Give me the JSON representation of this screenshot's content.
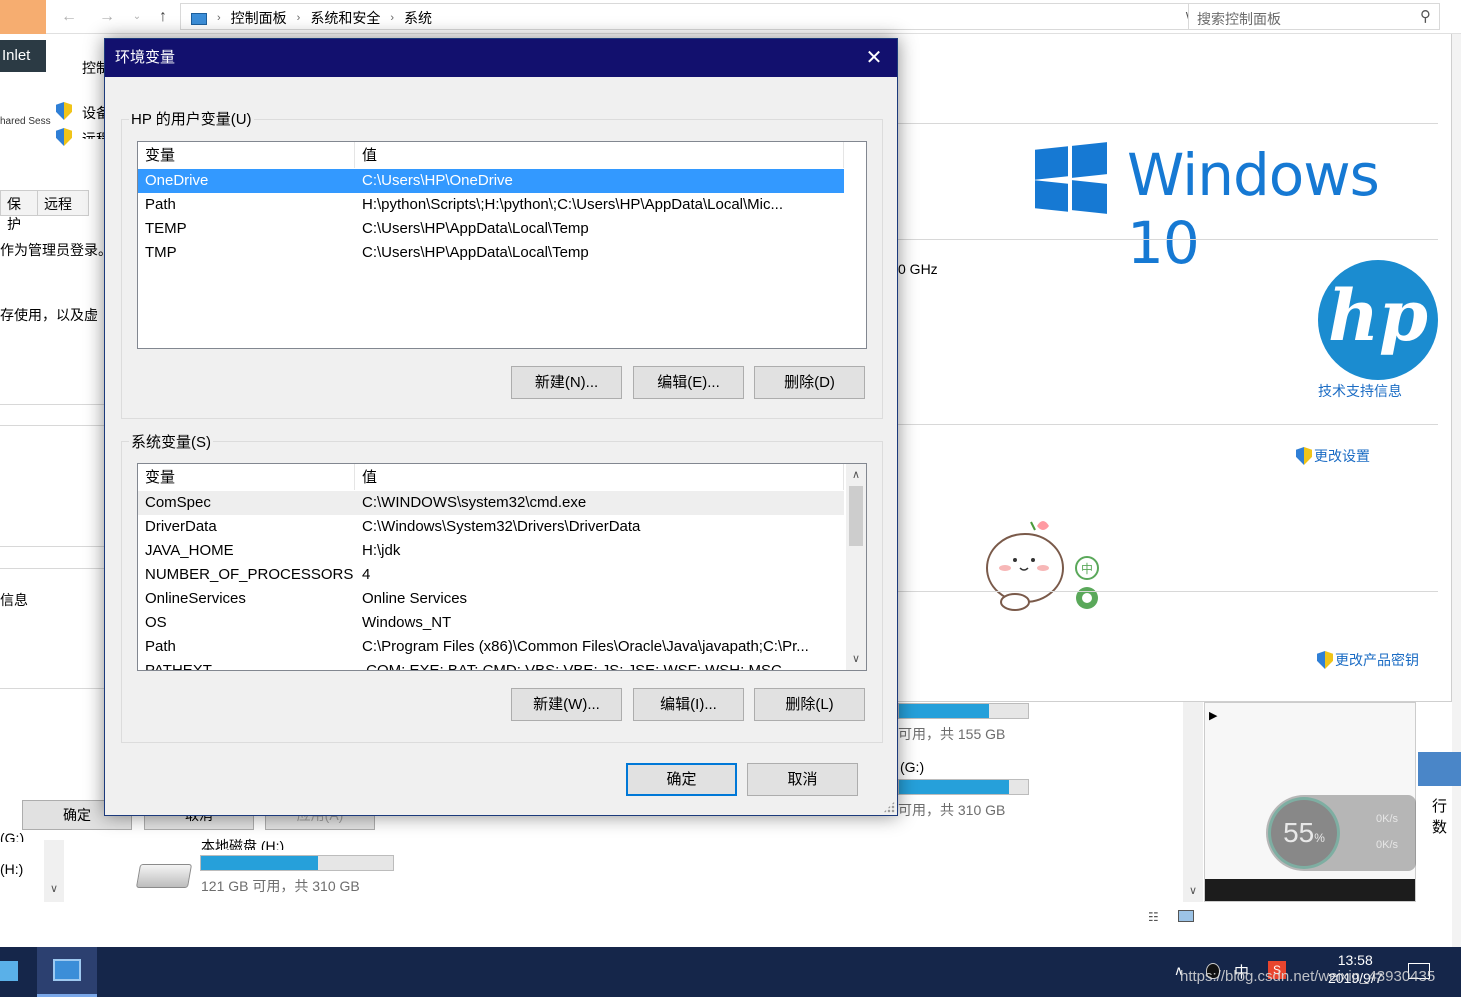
{
  "explorer": {
    "breadcrumbs": [
      "控制面板",
      "系统和安全",
      "系统"
    ],
    "search_placeholder": "搜索控制面板",
    "help_label": "?"
  },
  "system_page": {
    "windows_brand": "Windows 10",
    "cpu_freq_fragment": "0 GHz",
    "hp_logo_text": "hp",
    "tech_support_link": "技术支持信息",
    "change_settings_link": "更改设置",
    "change_product_key_link": "更改产品密钥"
  },
  "left_fragments": {
    "inlet": "Inlet",
    "shared_sess": "hared Sess",
    "left_link_1": "控制",
    "left_link_2": "设备",
    "left_link_3": "远程",
    "tab_protect": "保护",
    "tab_remote": "远程",
    "admin_text": "作为管理员登录。",
    "memory_text": "存使用，以及虚",
    "info_text": "信息",
    "drive_g_prefix": "(G:)",
    "drive_h_prefix": "(H:)"
  },
  "system_properties_buttons": {
    "ok": "确定",
    "cancel": "取消",
    "apply": "应用(A)"
  },
  "drives": [
    {
      "name": "",
      "free_text": "可用，共 155 GB",
      "fill": 0.7
    },
    {
      "name": "(G:)",
      "free_text": "可用，共 310 GB",
      "fill": 0.85
    },
    {
      "name": "本地磁盘 (H:)",
      "free_text": "121 GB 可用，共 310 GB",
      "fill": 0.61
    }
  ],
  "env_dialog": {
    "title": "环境变量",
    "close_icon": "close-icon",
    "user_group_label": "HP 的用户变量(U)",
    "system_group_label": "系统变量(S)",
    "col_variable": "变量",
    "col_value": "值",
    "user_vars": [
      {
        "name": "OneDrive",
        "value": "C:\\Users\\HP\\OneDrive",
        "selected": true
      },
      {
        "name": "Path",
        "value": "H:\\python\\Scripts\\;H:\\python\\;C:\\Users\\HP\\AppData\\Local\\Mic..."
      },
      {
        "name": "TEMP",
        "value": "C:\\Users\\HP\\AppData\\Local\\Temp"
      },
      {
        "name": "TMP",
        "value": "C:\\Users\\HP\\AppData\\Local\\Temp"
      }
    ],
    "system_vars": [
      {
        "name": "ComSpec",
        "value": "C:\\WINDOWS\\system32\\cmd.exe"
      },
      {
        "name": "DriverData",
        "value": "C:\\Windows\\System32\\Drivers\\DriverData"
      },
      {
        "name": "JAVA_HOME",
        "value": "H:\\jdk"
      },
      {
        "name": "NUMBER_OF_PROCESSORS",
        "value": "4"
      },
      {
        "name": "OnlineServices",
        "value": "Online Services"
      },
      {
        "name": "OS",
        "value": "Windows_NT"
      },
      {
        "name": "Path",
        "value": "C:\\Program Files (x86)\\Common Files\\Oracle\\Java\\javapath;C:\\Pr..."
      },
      {
        "name": "PATHEXT",
        "value": ".COM;.EXE;.BAT;.CMD;.VBS;.VBE;.JS;.JSE;.WSF;.WSH;.MSC"
      }
    ],
    "user_buttons": {
      "new": "新建(N)...",
      "edit": "编辑(E)...",
      "delete": "删除(D)"
    },
    "system_buttons": {
      "new": "新建(W)...",
      "edit": "编辑(I)...",
      "delete": "删除(L)"
    },
    "ok": "确定",
    "cancel": "取消"
  },
  "speed_widget": {
    "percent": "55",
    "percent_unit": "%",
    "up": "0K/s",
    "down": "0K/s"
  },
  "taskbar": {
    "time": "13:58",
    "date": "2019/9/7",
    "watermark": "https://blog.csdn.net/weixin_43930435"
  },
  "colors": {
    "accent": "#1679d3",
    "dialog_title": "#12106e",
    "selection": "#3399ff",
    "taskbar": "#15264a"
  }
}
